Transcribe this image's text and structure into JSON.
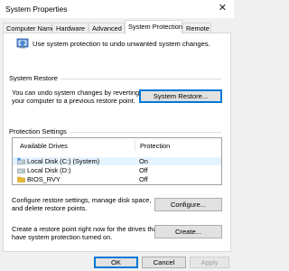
{
  "window": {
    "title": "System Properties",
    "close_glyph": "✕"
  },
  "tabs": [
    {
      "label": "Computer Name"
    },
    {
      "label": "Hardware"
    },
    {
      "label": "Advanced"
    },
    {
      "label": "System Protection"
    },
    {
      "label": "Remote"
    }
  ],
  "active_tab": "System Protection",
  "intro": {
    "text": "Use system protection to undo unwanted system changes.",
    "icon": "shield-icon"
  },
  "system_restore": {
    "header": "System Restore",
    "description_line1": "You can undo system changes by reverting",
    "description_line2": "your computer to a previous restore point.",
    "button_label": "System Restore..."
  },
  "protection_settings": {
    "header": "Protection Settings",
    "columns": [
      "Available Drives",
      "Protection"
    ],
    "drives": [
      {
        "name": "Local Disk (C:) (System)",
        "protection": "On",
        "icon": "system-drive-icon"
      },
      {
        "name": "Local Disk (D:)",
        "protection": "Off",
        "icon": "drive-icon"
      },
      {
        "name": "BIOS_RVY",
        "protection": "Off",
        "icon": "folder-drive-icon"
      }
    ],
    "configure_text_line1": "Configure restore settings, manage disk space,",
    "configure_text_line2": "and delete restore points.",
    "configure_button": "Configure...",
    "create_text_line1": "Create a restore point right now for the drives that",
    "create_text_line2": "have system protection turned on.",
    "create_button": "Create..."
  },
  "footer": {
    "ok": "OK",
    "cancel": "Cancel",
    "apply": "Apply"
  },
  "colors": {
    "accent": "#0078d7",
    "selected_row": "#e5f3ff",
    "folder": "#e8b830"
  }
}
